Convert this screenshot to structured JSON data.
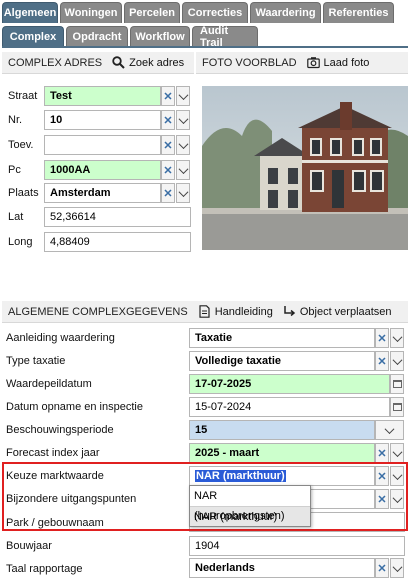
{
  "tabs_top": [
    "Algemeen",
    "Woningen",
    "Percelen",
    "Correcties",
    "Waardering",
    "Referenties"
  ],
  "tabs_sub": [
    "Complex",
    "Opdracht",
    "Workflow",
    "Audit Trail"
  ],
  "complex_adres": {
    "title": "COMPLEX ADRES",
    "search_label": "Zoek adres",
    "fields": [
      {
        "label": "Straat",
        "value": "Test"
      },
      {
        "label": "Nr.",
        "value": "10"
      },
      {
        "label": "Toev.",
        "value": ""
      },
      {
        "label": "Pc",
        "value": "1000AA"
      },
      {
        "label": "Plaats",
        "value": "Amsterdam"
      },
      {
        "label": "Lat",
        "value": "52,36614"
      },
      {
        "label": "Long",
        "value": "4,88409"
      }
    ]
  },
  "foto": {
    "title": "FOTO VOORBLAD",
    "action_label": "Laad foto"
  },
  "algemene": {
    "title": "ALGEMENE COMPLEXGEGEVENS",
    "handleiding_label": "Handleiding",
    "verplaatsen_label": "Object verplaatsen",
    "rows": [
      {
        "label": "Aanleiding waardering",
        "value": "Taxatie"
      },
      {
        "label": "Type taxatie",
        "value": "Volledige taxatie"
      },
      {
        "label": "Waardepeildatum",
        "value": "17-07-2025"
      },
      {
        "label": "Datum opname en inspectie",
        "value": "15-07-2024"
      },
      {
        "label": "Beschouwingsperiode",
        "value": "15"
      },
      {
        "label": "Forecast index jaar",
        "value": "2025 - maart"
      },
      {
        "label": "Keuze marktwaarde",
        "value": "NAR (markthuur)"
      },
      {
        "label": "Bijzondere uitgangspunten",
        "value": ""
      },
      {
        "label": "Park / gebouwnaam",
        "value": ""
      },
      {
        "label": "Bouwjaar",
        "value": "1904"
      },
      {
        "label": "Taal rapportage",
        "value": "Nederlands"
      }
    ]
  },
  "dropdown_options": [
    "NAR (huuropbrengsten)",
    "NAR (markthuur)"
  ],
  "colors": {
    "tab_active": "#4f6f87",
    "tab_inactive": "#8a8a8a",
    "field_green": "#ccffcc",
    "field_blue": "#c8dcf0",
    "highlight": "#e02020"
  }
}
